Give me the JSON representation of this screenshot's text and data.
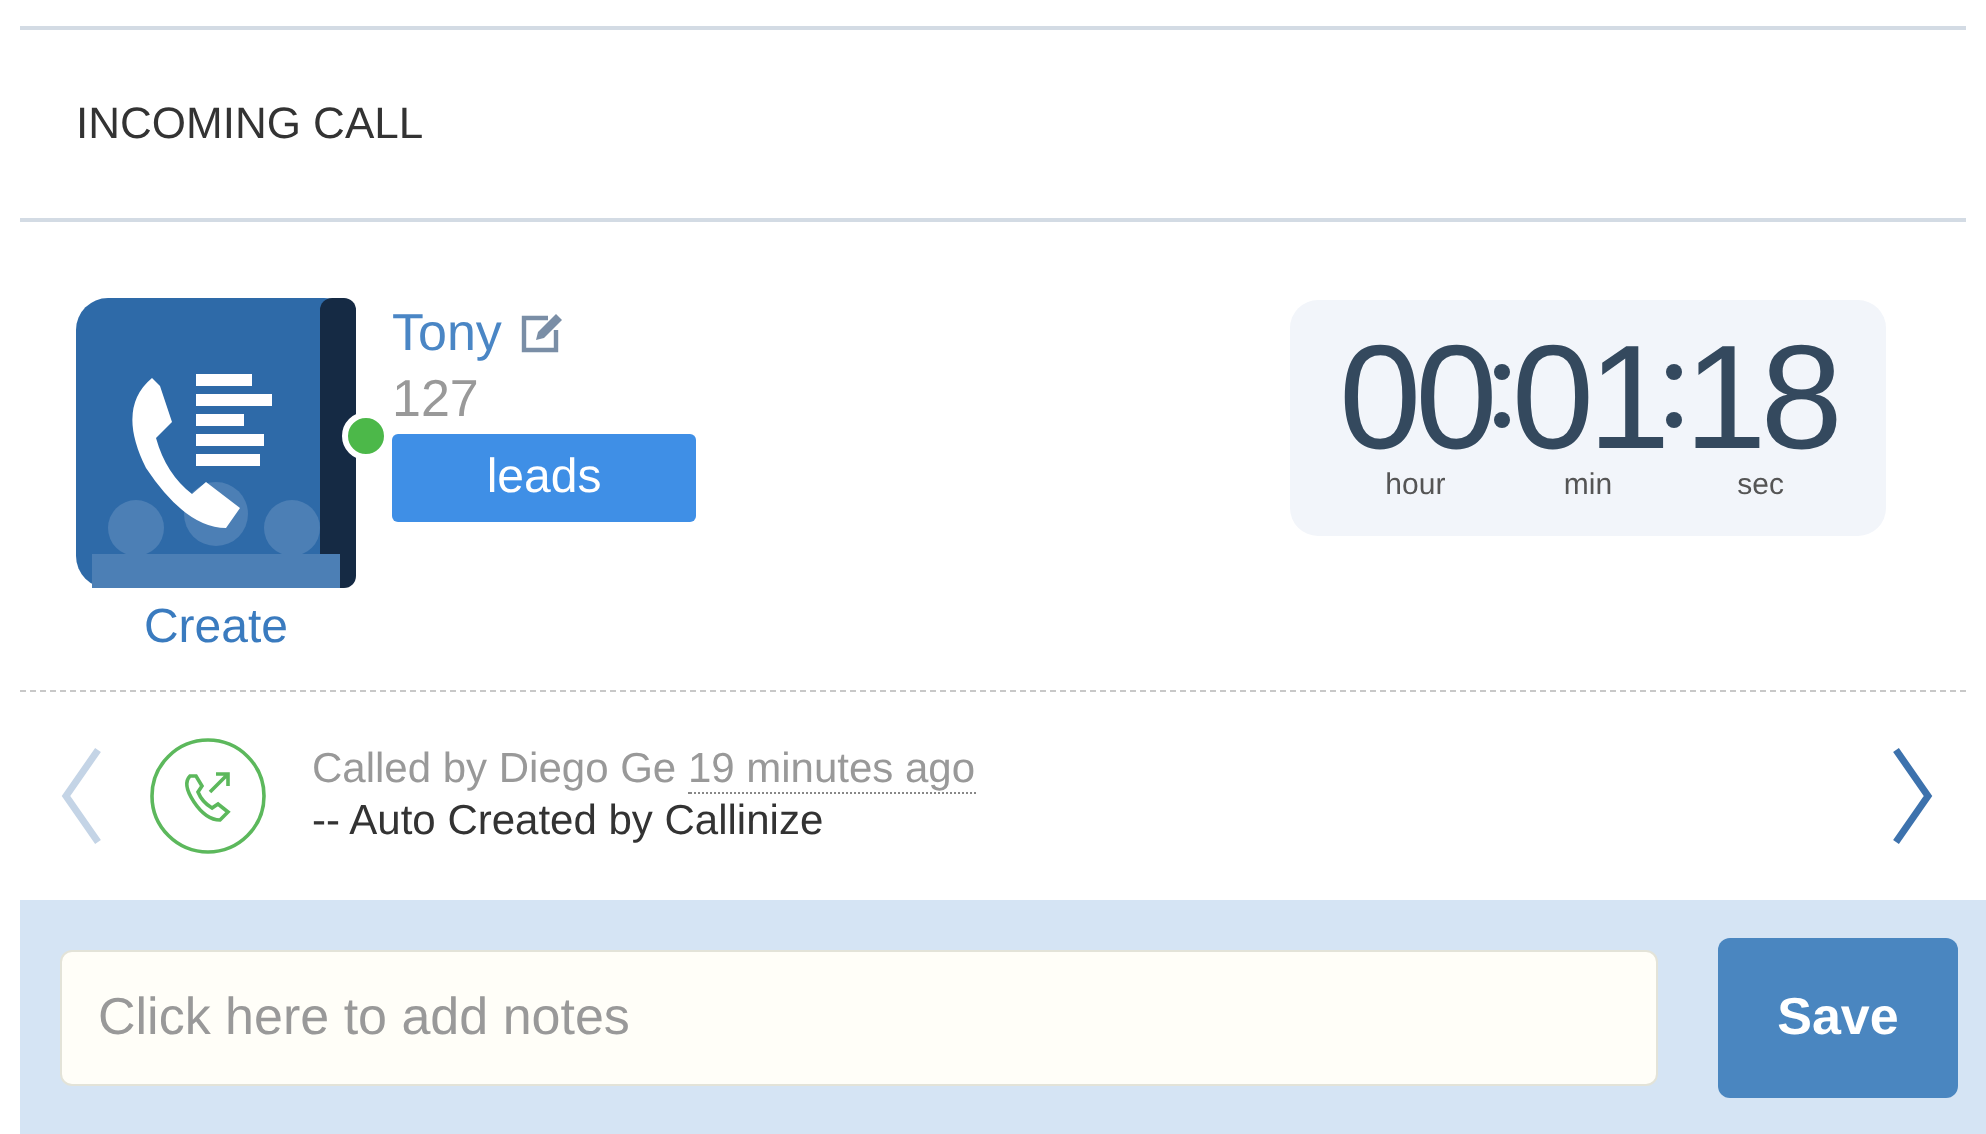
{
  "header": {
    "title": "INCOMING CALL"
  },
  "caller": {
    "name": "Tony",
    "number": "127",
    "tag": "leads",
    "online": true,
    "action": "Create"
  },
  "timer": {
    "parts": [
      {
        "value": "00",
        "unit": "hour"
      },
      {
        "value": "01",
        "unit": "min"
      },
      {
        "value": "18",
        "unit": "sec"
      }
    ]
  },
  "activity": {
    "called_by": "Called by Diego Ge",
    "time": "19 minutes ago",
    "note": "-- Auto Created by Callinize",
    "prev_disabled": true,
    "next_disabled": false
  },
  "notes": {
    "placeholder": "Click here to add notes",
    "button": "Save"
  }
}
